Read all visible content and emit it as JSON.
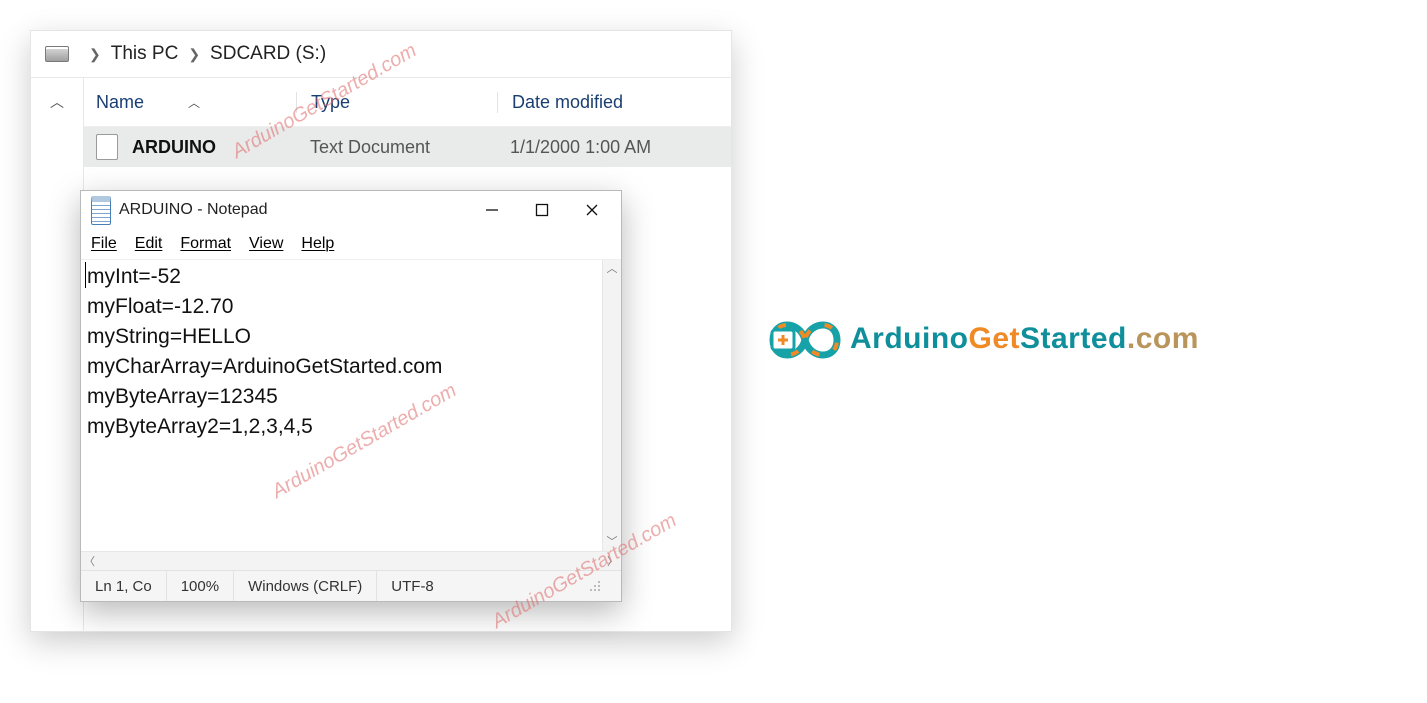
{
  "explorer": {
    "breadcrumb": {
      "level1": "This PC",
      "level2": "SDCARD (S:)"
    },
    "columns": {
      "name": "Name",
      "type": "Type",
      "date": "Date modified"
    },
    "file": {
      "name": "ARDUINO",
      "type": "Text Document",
      "date": "1/1/2000 1:00 AM"
    }
  },
  "notepad": {
    "title": "ARDUINO - Notepad",
    "menu": {
      "file": "File",
      "edit": "Edit",
      "format": "Format",
      "view": "View",
      "help": "Help"
    },
    "lines": {
      "l1": "myInt=-52",
      "l2": "myFloat=-12.70",
      "l3": "myString=HELLO",
      "l4": "myCharArray=ArduinoGetStarted.com",
      "l5": "myByteArray=12345",
      "l6": "myByteArray2=1,2,3,4,5"
    },
    "status": {
      "pos": "Ln 1, Co",
      "zoom": "100%",
      "eol": "Windows (CRLF)",
      "enc": "UTF-8"
    }
  },
  "watermark": "ArduinoGetStarted.com",
  "logo": {
    "part1": "Arduino",
    "part2": "Get",
    "part3": "Started",
    "part4": ".com"
  }
}
